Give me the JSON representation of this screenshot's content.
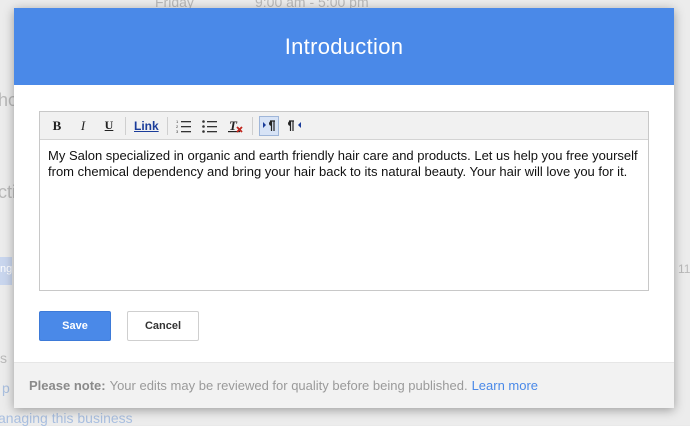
{
  "background": {
    "hours_day": "Friday",
    "hours_time": "9:00 am - 5:00 pm",
    "frag_left_1": "ho",
    "frag_left_2": "cti",
    "frag_tag": "ng",
    "frag_right": "11",
    "frag_s": "s",
    "frag_p": "p",
    "frag_bottom": "anaging this business"
  },
  "dialog": {
    "title": "Introduction",
    "toolbar": {
      "bold": "B",
      "italic": "I",
      "underline": "U",
      "link": "Link"
    },
    "body_text": "My Salon specialized in organic and earth friendly hair care and products.  Let us help you free yourself from chemical dependency and bring your hair back to its natural beauty.  Your hair will love you for it.",
    "save_label": "Save",
    "cancel_label": "Cancel",
    "footer": {
      "note_label": "Please note:",
      "note_text": "Your edits may be reviewed for quality before being published.",
      "learn_more": "Learn more"
    }
  },
  "colors": {
    "accent": "#4a89e8"
  }
}
